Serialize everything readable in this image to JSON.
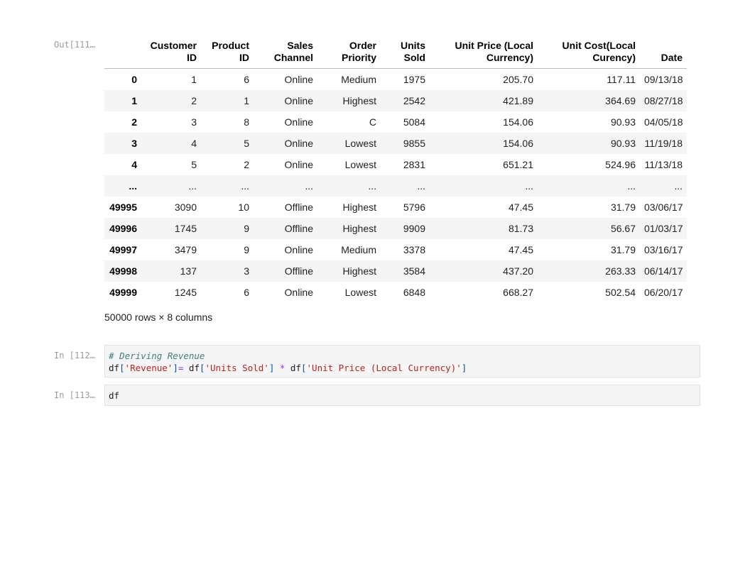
{
  "out_prompt": "Out[111…",
  "table": {
    "columns": [
      {
        "line1": "",
        "line2": ""
      },
      {
        "line1": "Customer",
        "line2": "ID"
      },
      {
        "line1": "Product",
        "line2": "ID"
      },
      {
        "line1": "Sales",
        "line2": "Channel"
      },
      {
        "line1": "Order",
        "line2": "Priority"
      },
      {
        "line1": "Units",
        "line2": "Sold"
      },
      {
        "line1": "Unit Price (Local",
        "line2": "Currency)"
      },
      {
        "line1": "Unit Cost(Local",
        "line2": "Curency)"
      },
      {
        "line1": "",
        "line2": "Date"
      }
    ],
    "rows": [
      [
        "0",
        "1",
        "6",
        "Online",
        "Medium",
        "1975",
        "205.70",
        "117.11",
        "09/13/18"
      ],
      [
        "1",
        "2",
        "1",
        "Online",
        "Highest",
        "2542",
        "421.89",
        "364.69",
        "08/27/18"
      ],
      [
        "2",
        "3",
        "8",
        "Online",
        "C",
        "5084",
        "154.06",
        "90.93",
        "04/05/18"
      ],
      [
        "3",
        "4",
        "5",
        "Online",
        "Lowest",
        "9855",
        "154.06",
        "90.93",
        "11/19/18"
      ],
      [
        "4",
        "5",
        "2",
        "Online",
        "Lowest",
        "2831",
        "651.21",
        "524.96",
        "11/13/18"
      ],
      [
        "...",
        "...",
        "...",
        "...",
        "...",
        "...",
        "...",
        "...",
        "..."
      ],
      [
        "49995",
        "3090",
        "10",
        "Offline",
        "Highest",
        "5796",
        "47.45",
        "31.79",
        "03/06/17"
      ],
      [
        "49996",
        "1745",
        "9",
        "Offline",
        "Highest",
        "9909",
        "81.73",
        "56.67",
        "01/03/17"
      ],
      [
        "49997",
        "3479",
        "9",
        "Online",
        "Medium",
        "3378",
        "47.45",
        "31.79",
        "03/16/17"
      ],
      [
        "49998",
        "137",
        "3",
        "Offline",
        "Highest",
        "3584",
        "437.20",
        "263.33",
        "06/14/17"
      ],
      [
        "49999",
        "1245",
        "6",
        "Online",
        "Lowest",
        "6848",
        "668.27",
        "502.54",
        "06/20/17"
      ]
    ],
    "shape": "50000 rows × 8 columns"
  },
  "cell_112": {
    "prompt": "In [112…",
    "comment": "# Deriving Revenue",
    "code": {
      "df1": "df",
      "br1": "[",
      "s_revenue": "'Revenue'",
      "br2": "]",
      "assign": "=",
      "df2": " df",
      "br3": "[",
      "s_units": "'Units Sold'",
      "br4": "]",
      "mult": " * ",
      "df3": "df",
      "br5": "[",
      "s_price": "'Unit Price (Local Currency)'",
      "br6": "]"
    }
  },
  "cell_113": {
    "prompt": "In [113…",
    "code": "df"
  }
}
